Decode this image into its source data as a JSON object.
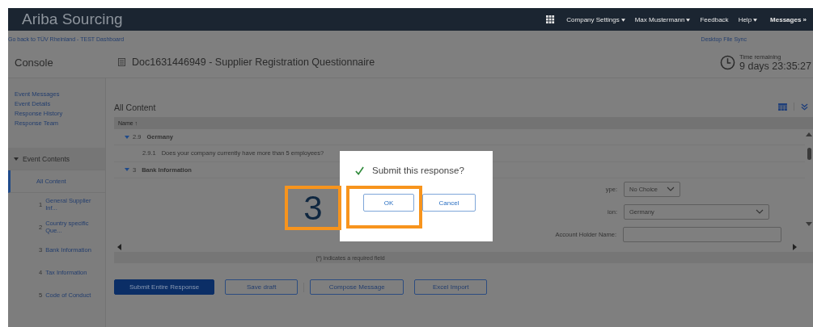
{
  "header": {
    "brand": "Ariba Sourcing",
    "menu": [
      {
        "label": "Company Settings",
        "dropdown": true
      },
      {
        "label": "Max Mustermann",
        "dropdown": true
      },
      {
        "label": "Feedback",
        "dropdown": false
      },
      {
        "label": "Help",
        "dropdown": true
      }
    ],
    "messages": "Messages",
    "messages_arrow": "»"
  },
  "back_link": "Go back to TÜV Rheinland - TEST Dashboard",
  "sync_link": "Desktop File Sync",
  "console_title": "Console",
  "document_title": "Doc1631446949 - Supplier Registration Questionnaire",
  "time": {
    "label": "Time remaining",
    "value": "9 days 23:35:27"
  },
  "sidebar": {
    "links": [
      "Event Messages",
      "Event Details",
      "Response History",
      "Response Team"
    ],
    "section": {
      "label": "Event Contents",
      "expanded": true,
      "children": [
        {
          "label": "All Content",
          "selected": true
        },
        {
          "number": "1",
          "label": "General Supplier Inf...",
          "selected": false
        },
        {
          "number": "2",
          "label": "Country specific Que...",
          "selected": false
        },
        {
          "number": "3",
          "label": "Bank Information",
          "selected": false
        },
        {
          "number": "4",
          "label": "Tax Information",
          "selected": false
        },
        {
          "number": "5",
          "label": "Code of Conduct",
          "selected": false
        }
      ]
    }
  },
  "content": {
    "title": "All Content",
    "column": "Name ↑",
    "rows": [
      {
        "number": "2.9",
        "label": "Germany",
        "expanded": true,
        "children": [
          {
            "number": "2.9.1",
            "label": "Does your company currently have more than 5 employees?"
          }
        ]
      },
      {
        "number": "3",
        "label": "Bank Information",
        "expanded": true
      }
    ],
    "form": [
      {
        "kind": "select",
        "label": "ype:",
        "value": "No Choice"
      },
      {
        "kind": "select",
        "label": "ion:",
        "value": "Germany"
      },
      {
        "kind": "text",
        "label": "Account Holder Name:"
      }
    ],
    "footer": "(*) indicates a required field"
  },
  "buttons": [
    {
      "label": "Submit Entire Response",
      "primary": true
    },
    {
      "label": "Save draft",
      "primary": false
    },
    {
      "label": "Compose Message",
      "primary": false
    },
    {
      "label": "Excel Import",
      "primary": false
    }
  ],
  "dialog": {
    "title": "Submit this response?",
    "buttons": [
      {
        "label": "OK",
        "highlighted": true
      },
      {
        "label": "Cancel",
        "highlighted": false
      }
    ]
  },
  "annotation": {
    "step": "3"
  }
}
